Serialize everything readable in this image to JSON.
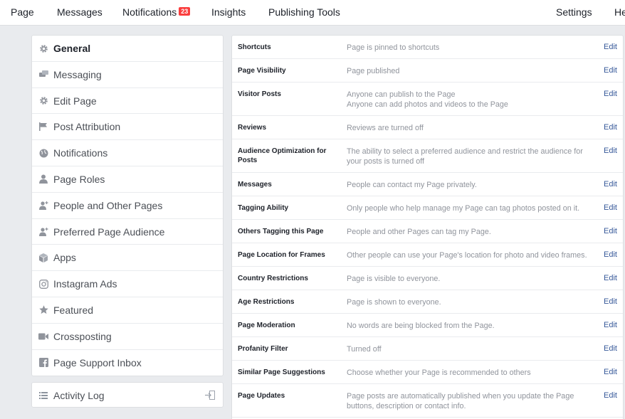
{
  "topnav": {
    "page": "Page",
    "messages": "Messages",
    "notifications": "Notifications",
    "notifications_badge": "23",
    "insights": "Insights",
    "publishing_tools": "Publishing Tools",
    "settings": "Settings",
    "help": "Help"
  },
  "sidebar": {
    "items": [
      {
        "label": "General",
        "icon": "gear-icon"
      },
      {
        "label": "Messaging",
        "icon": "messaging-icon"
      },
      {
        "label": "Edit Page",
        "icon": "gear-icon"
      },
      {
        "label": "Post Attribution",
        "icon": "flag-icon"
      },
      {
        "label": "Notifications",
        "icon": "globe-icon"
      },
      {
        "label": "Page Roles",
        "icon": "person-icon"
      },
      {
        "label": "People and Other Pages",
        "icon": "person-add-icon"
      },
      {
        "label": "Preferred Page Audience",
        "icon": "person-add-icon"
      },
      {
        "label": "Apps",
        "icon": "cube-icon"
      },
      {
        "label": "Instagram Ads",
        "icon": "instagram-icon"
      },
      {
        "label": "Featured",
        "icon": "star-icon"
      },
      {
        "label": "Crossposting",
        "icon": "video-camera-icon"
      },
      {
        "label": "Page Support Inbox",
        "icon": "facebook-icon"
      }
    ],
    "activity_log": "Activity Log"
  },
  "settings": {
    "edit_label": "Edit",
    "rows": [
      {
        "name": "Shortcuts",
        "desc": [
          "Page is pinned to shortcuts"
        ]
      },
      {
        "name": "Page Visibility",
        "desc": [
          "Page published"
        ]
      },
      {
        "name": "Visitor Posts",
        "desc": [
          "Anyone can publish to the Page",
          "Anyone can add photos and videos to the Page"
        ]
      },
      {
        "name": "Reviews",
        "desc": [
          "Reviews are turned off"
        ]
      },
      {
        "name": "Audience Optimization for Posts",
        "desc": [
          "The ability to select a preferred audience and restrict the audience for your posts is turned off"
        ]
      },
      {
        "name": "Messages",
        "desc": [
          "People can contact my Page privately."
        ]
      },
      {
        "name": "Tagging Ability",
        "desc": [
          "Only people who help manage my Page can tag photos posted on it."
        ]
      },
      {
        "name": "Others Tagging this Page",
        "desc": [
          "People and other Pages can tag my Page."
        ]
      },
      {
        "name": "Page Location for Frames",
        "desc": [
          "Other people can use your Page's location for photo and video frames."
        ]
      },
      {
        "name": "Country Restrictions",
        "desc": [
          "Page is visible to everyone."
        ]
      },
      {
        "name": "Age Restrictions",
        "desc": [
          "Page is shown to everyone."
        ]
      },
      {
        "name": "Page Moderation",
        "desc": [
          "No words are being blocked from the Page."
        ]
      },
      {
        "name": "Profanity Filter",
        "desc": [
          "Turned off"
        ]
      },
      {
        "name": "Similar Page Suggestions",
        "desc": [
          "Choose whether your Page is recommended to others"
        ]
      },
      {
        "name": "Page Updates",
        "desc": [
          "Page posts are automatically published when you update the Page buttons, description or contact info."
        ]
      }
    ]
  },
  "colors": {
    "link": "#365899",
    "badge": "#fa3e3e",
    "muted": "#90949c",
    "background": "#e9ebee"
  }
}
